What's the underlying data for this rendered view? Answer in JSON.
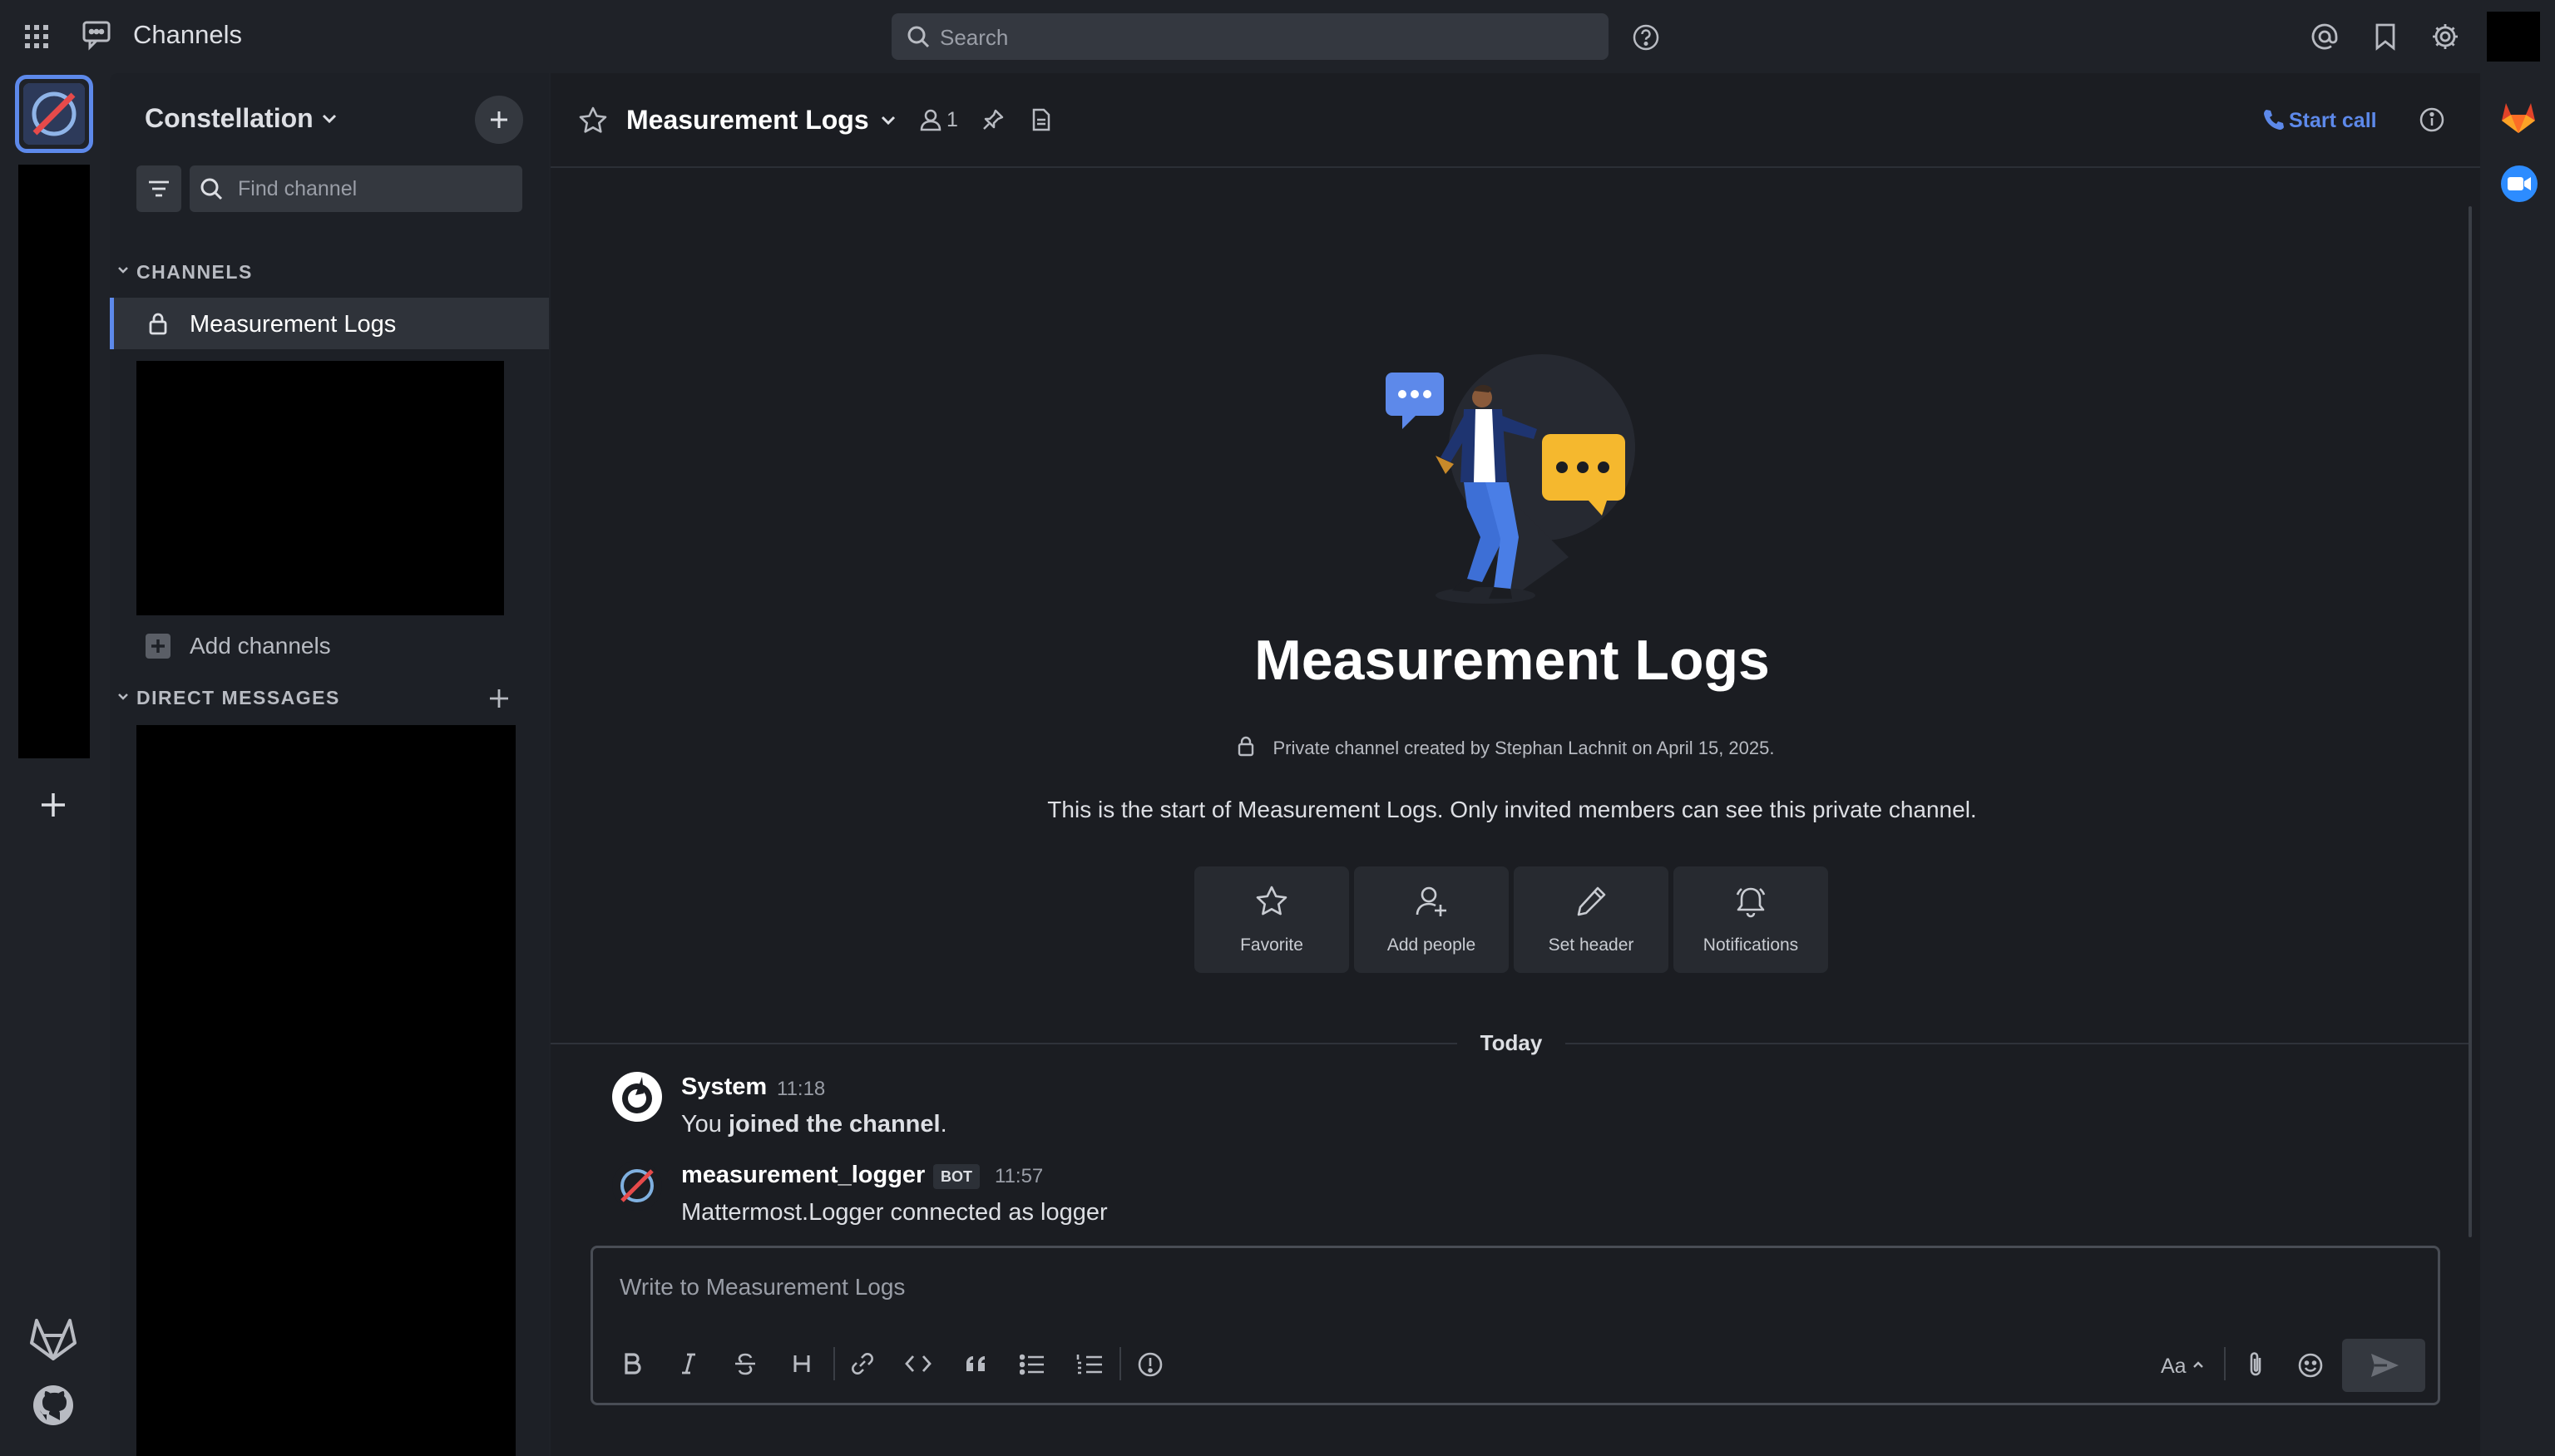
{
  "app": {
    "product_name": "Channels"
  },
  "search": {
    "placeholder": "Search"
  },
  "team": {
    "name": "Constellation"
  },
  "sidebar": {
    "find_placeholder": "Find channel",
    "channels_header": "CHANNELS",
    "channels": [
      {
        "label": "Measurement Logs",
        "private": true,
        "active": true
      }
    ],
    "add_channels_label": "Add channels",
    "dm_header": "DIRECT MESSAGES"
  },
  "channel": {
    "title": "Measurement Logs",
    "member_count": "1",
    "start_call_label": "Start call"
  },
  "intro": {
    "title": "Measurement Logs",
    "meta": "Private channel created by Stephan Lachnit on April 15, 2025.",
    "description": "This is the start of Measurement Logs. Only invited members can see this private channel.",
    "actions": [
      {
        "label": "Favorite",
        "icon": "star-icon"
      },
      {
        "label": "Add people",
        "icon": "add-user-icon"
      },
      {
        "label": "Set header",
        "icon": "pencil-icon"
      },
      {
        "label": "Notifications",
        "icon": "bell-icon"
      }
    ]
  },
  "timeline": {
    "date_separator": "Today",
    "posts": [
      {
        "author": "System",
        "time": "11:18",
        "text_prefix": "You ",
        "text_bold": "joined the channel",
        "text_suffix": "."
      },
      {
        "author": "measurement_logger",
        "badge": "BOT",
        "time": "11:57",
        "text": "Mattermost.Logger connected as logger"
      }
    ]
  },
  "composer": {
    "placeholder": "Write to Measurement Logs",
    "format_label": "Aa"
  },
  "colors": {
    "accent": "#5d89ea",
    "background": "#1b1d22",
    "sidebar": "#1d2026",
    "notification_yellow": "#f5b82e"
  }
}
